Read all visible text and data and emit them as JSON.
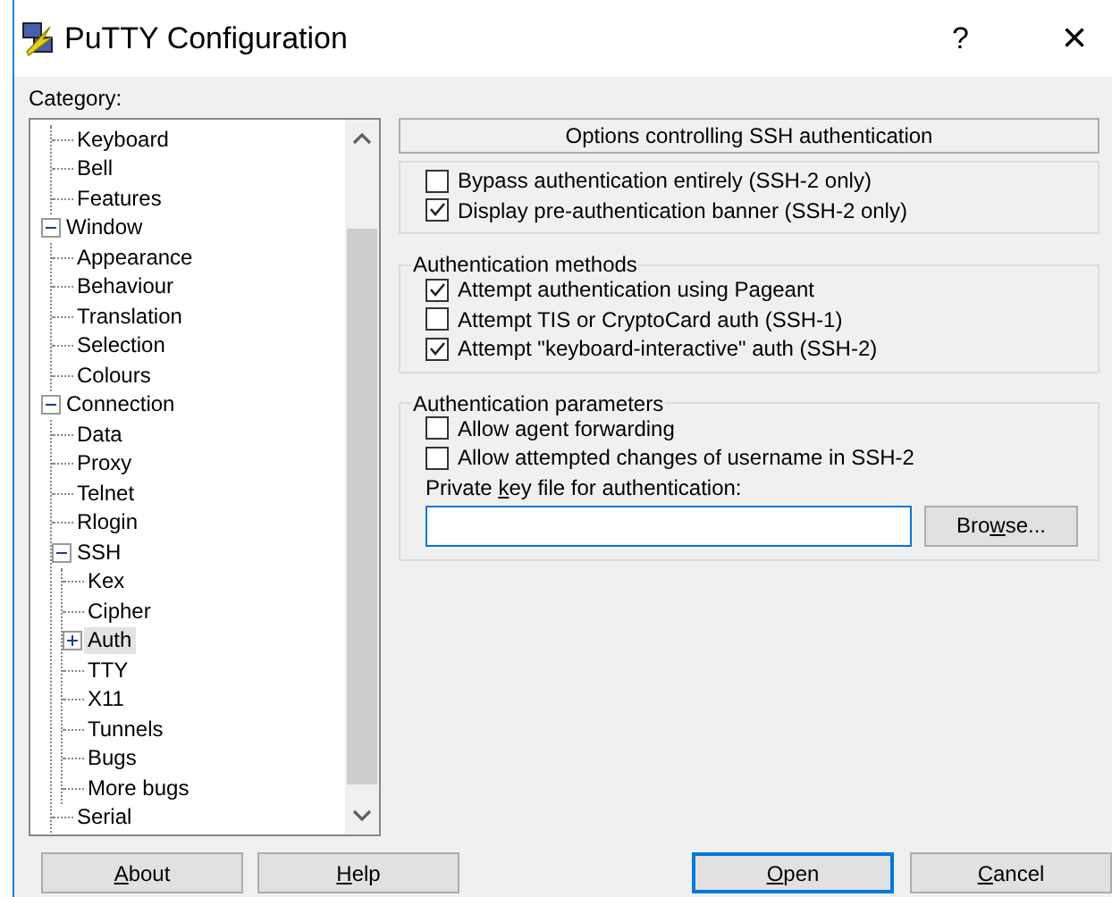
{
  "window": {
    "title": "PuTTY Configuration",
    "help_glyph": "?",
    "close_glyph": "×"
  },
  "category_label": "Category:",
  "tree": [
    {
      "children": [
        {
          "label": "Keyboard",
          "selected": false
        },
        {
          "label": "Bell",
          "selected": false
        },
        {
          "label": "Features",
          "selected": false
        }
      ]
    },
    {
      "label": "Window",
      "expanded": true,
      "selected": false,
      "children": [
        {
          "label": "Appearance",
          "selected": false
        },
        {
          "label": "Behaviour",
          "selected": false
        },
        {
          "label": "Translation",
          "selected": false
        },
        {
          "label": "Selection",
          "selected": false
        },
        {
          "label": "Colours",
          "selected": false
        }
      ]
    },
    {
      "label": "Connection",
      "expanded": true,
      "selected": false,
      "children": [
        {
          "label": "Data",
          "selected": false
        },
        {
          "label": "Proxy",
          "selected": false
        },
        {
          "label": "Telnet",
          "selected": false
        },
        {
          "label": "Rlogin",
          "selected": false
        },
        {
          "label": "SSH",
          "expanded": true,
          "selected": false,
          "children": [
            {
              "label": "Kex",
              "selected": false
            },
            {
              "label": "Cipher",
              "selected": false
            },
            {
              "label": "Auth",
              "expanded": false,
              "selected": true
            },
            {
              "label": "TTY",
              "selected": false
            },
            {
              "label": "X11",
              "selected": false
            },
            {
              "label": "Tunnels",
              "selected": false
            },
            {
              "label": "Bugs",
              "selected": false
            },
            {
              "label": "More bugs",
              "selected": false
            }
          ]
        },
        {
          "label": "Serial",
          "selected": false
        }
      ]
    }
  ],
  "panel": {
    "header": "Options controlling SSH authentication",
    "groups": [
      {
        "options": [
          {
            "label": "Bypass authentication entirely (SSH-2 only)",
            "checked": false
          },
          {
            "label": "Display pre-authentication banner (SSH-2 only)",
            "checked": true
          }
        ]
      },
      {
        "title": "Authentication methods",
        "options": [
          {
            "label": "Attempt authentication using Pageant",
            "checked": true
          },
          {
            "label": "Attempt TIS or CryptoCard auth (SSH-1)",
            "checked": false
          },
          {
            "label": "Attempt \"keyboard-interactive\" auth (SSH-2)",
            "checked": true
          }
        ]
      },
      {
        "title": "Authentication parameters",
        "options": [
          {
            "label": "Allow agent forwarding",
            "checked": false
          },
          {
            "label": "Allow attempted changes of username in SSH-2",
            "checked": false
          }
        ],
        "file_field": {
          "label": {
            "before": "Private ",
            "key": "k",
            "after": "ey file for authentication:"
          },
          "button": {
            "before": "Bro",
            "key": "w",
            "after": "se..."
          }
        }
      }
    ]
  },
  "buttons_left": [
    {
      "key": "A",
      "after": "bout",
      "default": false
    },
    {
      "key": "H",
      "after": "elp",
      "default": false
    }
  ],
  "buttons_right": [
    {
      "key": "O",
      "after": "pen",
      "default": true
    },
    {
      "key": "C",
      "after": "ancel",
      "default": false
    }
  ]
}
